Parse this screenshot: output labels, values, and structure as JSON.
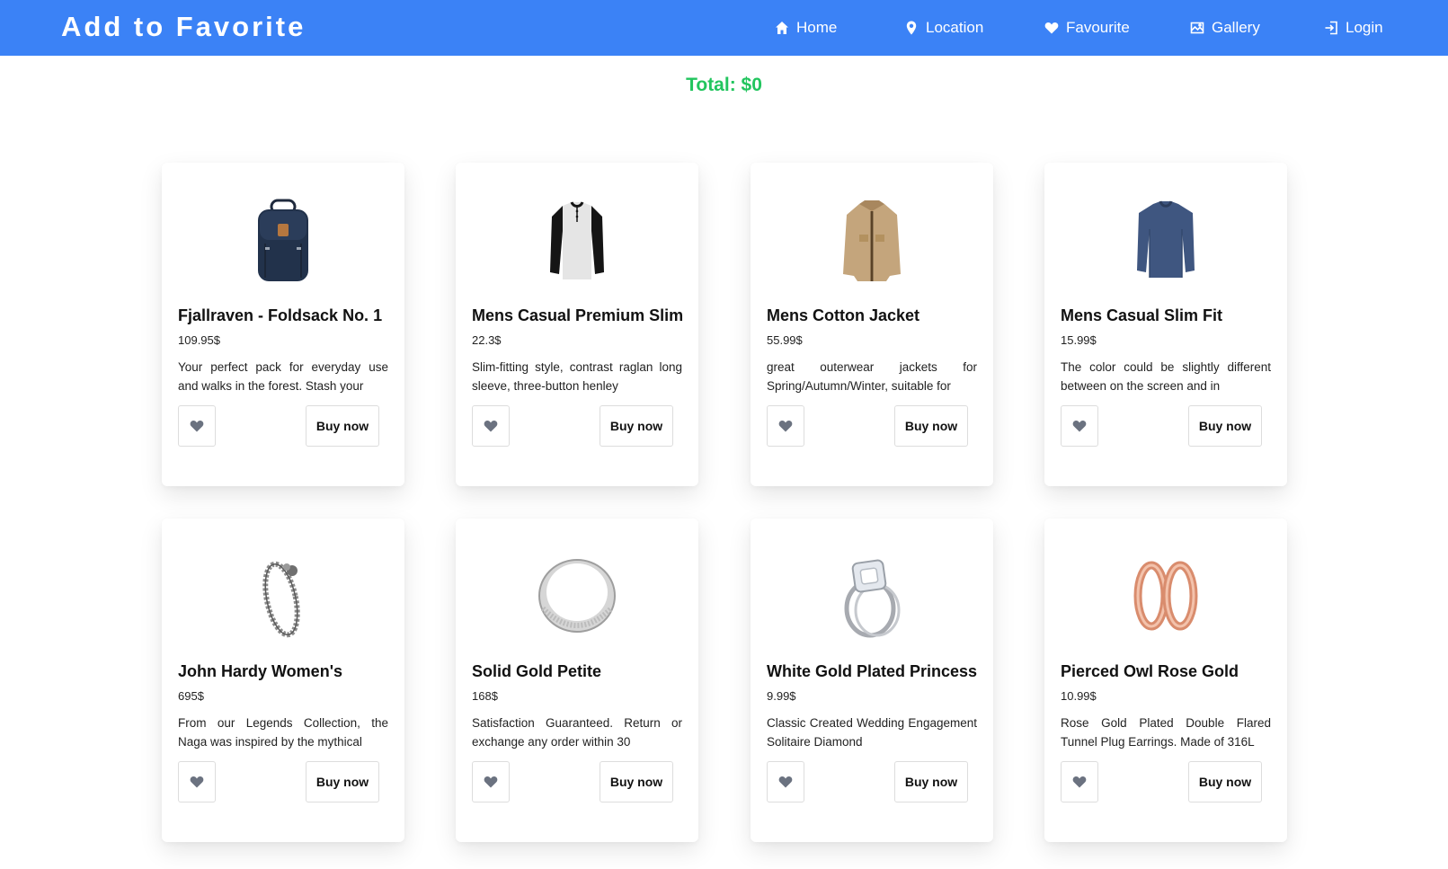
{
  "brand": "Add to Favorite",
  "nav": {
    "home": "Home",
    "location": "Location",
    "favourite": "Favourite",
    "gallery": "Gallery",
    "login": "Login"
  },
  "total": "Total: $0",
  "buy_label": "Buy now",
  "colors": {
    "navbar": "#3b82f6",
    "total": "#22c55e",
    "favorite_icon": "#6b7280"
  },
  "products": [
    {
      "title": "Fjallraven - Foldsack No. 1",
      "price": "109.95$",
      "description": "Your perfect pack for everyday use and walks in the forest. Stash your",
      "image": "backpack"
    },
    {
      "title": "Mens Casual Premium Slim",
      "price": "22.3$",
      "description": "Slim-fitting style, contrast raglan long sleeve, three-button henley",
      "image": "raglan-tshirt"
    },
    {
      "title": "Mens Cotton Jacket",
      "price": "55.99$",
      "description": "great outerwear jackets for Spring/Autumn/Winter, suitable for",
      "image": "cotton-jacket"
    },
    {
      "title": "Mens Casual Slim Fit",
      "price": "15.99$",
      "description": "The color could be slightly different between on the screen and in",
      "image": "long-sleeve-shirt"
    },
    {
      "title": "John Hardy Women's",
      "price": "695$",
      "description": "From our Legends Collection, the Naga was inspired by the mythical",
      "image": "dragon-bracelet"
    },
    {
      "title": "Solid Gold Petite",
      "price": "168$",
      "description": "Satisfaction Guaranteed. Return or exchange any order within 30",
      "image": "silver-ring"
    },
    {
      "title": "White Gold Plated Princess",
      "price": "9.99$",
      "description": "Classic Created Wedding Engagement Solitaire Diamond",
      "image": "diamond-ring"
    },
    {
      "title": "Pierced Owl Rose Gold",
      "price": "10.99$",
      "description": "Rose Gold Plated Double Flared Tunnel Plug Earrings. Made of 316L",
      "image": "rose-gold-earrings"
    }
  ]
}
